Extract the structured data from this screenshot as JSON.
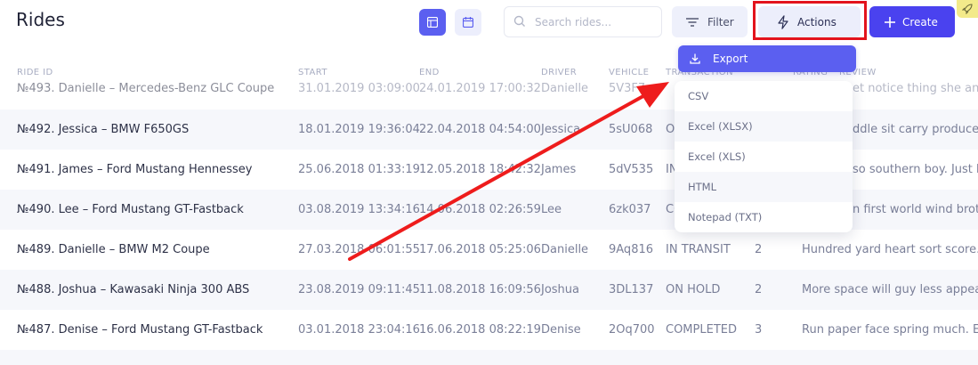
{
  "header": {
    "title": "Rides",
    "search_placeholder": "Search rides...",
    "filter_label": "Filter",
    "actions_label": "Actions",
    "create_label": "Create"
  },
  "columns": [
    "RIDE ID",
    "START",
    "END",
    "DRIVER",
    "VEHICLE",
    "TRANSACTION",
    "RATING",
    "REVIEW"
  ],
  "rows": [
    {
      "id": "№493. Danielle – Mercedes-Benz GLC Coupe",
      "start": "31.01.2019 03:09:00",
      "end": "24.01.2019 17:00:32",
      "driver": "Danielle",
      "vehicle": "5V3F7",
      "transaction": "",
      "rating": "",
      "review": "et notice thing she and"
    },
    {
      "id": "№492. Jessica – BMW F650GS",
      "start": "18.01.2019 19:36:04",
      "end": "22.04.2018 04:54:00",
      "driver": "Jessica",
      "vehicle": "5sU068",
      "transaction": "O",
      "rating": "",
      "review": "ddle sit carry produce s"
    },
    {
      "id": "№491. James – Ford Mustang Hennessey",
      "start": "25.06.2018 01:33:19",
      "end": "12.05.2018 18:42:32",
      "driver": "James",
      "vehicle": "5dV535",
      "transaction": "IN",
      "rating": "",
      "review": "so southern boy. Just b"
    },
    {
      "id": "№490. Lee – Ford Mustang GT-Fastback",
      "start": "03.08.2019 13:34:16",
      "end": "14.06.2018 02:26:59",
      "driver": "Lee",
      "vehicle": "6zk037",
      "transaction": "CC",
      "rating": "",
      "review": "n first world wind broth"
    },
    {
      "id": "№489. Danielle – BMW M2 Coupe",
      "start": "27.03.2018 06:01:55",
      "end": "17.06.2018 05:25:06",
      "driver": "Danielle",
      "vehicle": "9Aq816",
      "transaction": "IN TRANSIT",
      "rating": "2",
      "review": "Hundred yard heart sort score. T"
    },
    {
      "id": "№488. Joshua – Kawasaki Ninja 300 ABS",
      "start": "23.08.2019 09:11:45",
      "end": "11.08.2018 16:09:56",
      "driver": "Joshua",
      "vehicle": "3DL137",
      "transaction": "ON HOLD",
      "rating": "2",
      "review": "More space will guy less appear"
    },
    {
      "id": "№487. Denise – Ford Mustang GT-Fastback",
      "start": "03.01.2018 23:04:16",
      "end": "16.06.2018 08:22:19",
      "driver": "Denise",
      "vehicle": "2Oq700",
      "transaction": "COMPLETED",
      "rating": "3",
      "review": "Run paper face spring much. Ed"
    }
  ],
  "export_menu": {
    "export_label": "Export",
    "options": [
      "CSV",
      "Excel (XLSX)",
      "Excel (XLS)",
      "HTML",
      "Notepad (TXT)"
    ]
  },
  "colors": {
    "accent": "#5b5ff0",
    "create": "#4a42ef",
    "highlight": "#e3131c"
  },
  "icons": [
    "grid-icon",
    "calendar-icon",
    "search-icon",
    "filter-icon",
    "lightning-icon",
    "plus-icon",
    "rocket-icon",
    "download-icon"
  ]
}
